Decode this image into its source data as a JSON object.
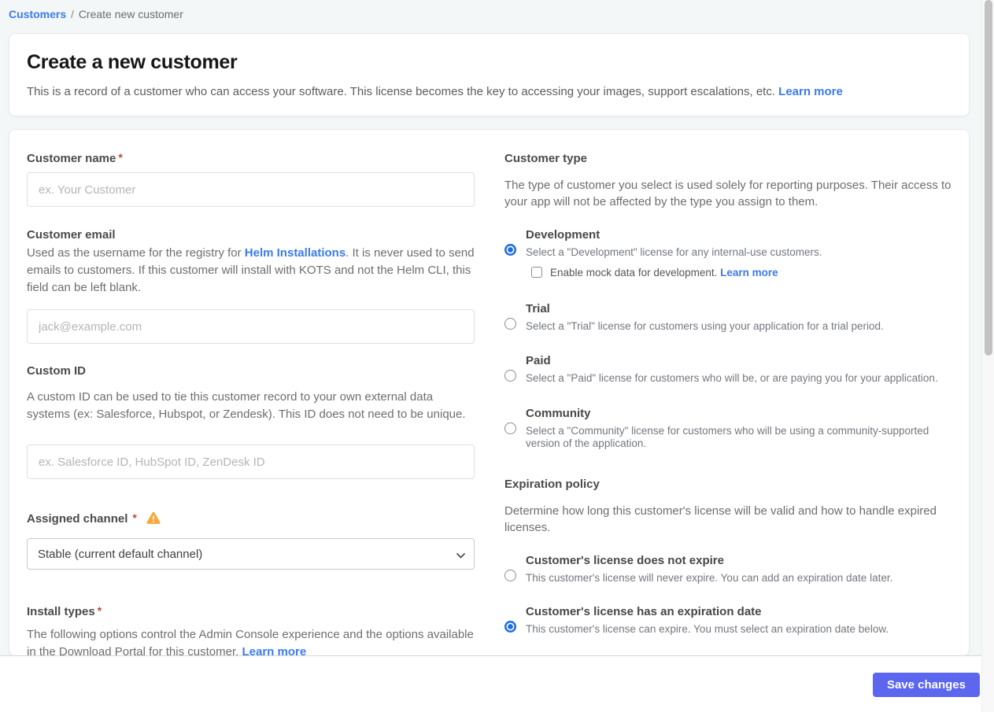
{
  "breadcrumb": {
    "link": "Customers",
    "separator": "/",
    "current": "Create new customer"
  },
  "header": {
    "title": "Create a new customer",
    "description": "This is a record of a customer who can access your software. This license becomes the key to accessing your images, support escalations, etc. ",
    "learn_more": "Learn more"
  },
  "ui": {
    "required_mark": "*"
  },
  "form": {
    "customer_name": {
      "label": "Customer name",
      "placeholder": "ex. Your Customer"
    },
    "customer_email": {
      "label": "Customer email",
      "description_before_link": "Used as the username for the registry for ",
      "link": "Helm Installations",
      "description_after_link": ". It is never used to send emails to customers. If this customer will install with KOTS and not the Helm CLI, this field can be left blank.",
      "placeholder": "jack@example.com"
    },
    "custom_id": {
      "label": "Custom ID",
      "description": "A custom ID can be used to tie this customer record to your own external data systems (ex: Salesforce, Hubspot, or Zendesk). This ID does not need to be unique.",
      "placeholder": "ex. Salesforce ID, HubSpot ID, ZenDesk ID"
    },
    "assigned_channel": {
      "label": "Assigned channel",
      "selected_option": "Stable (current default channel)"
    },
    "install_types": {
      "label": "Install types",
      "description": "The following options control the Admin Console experience and the options available in the Download Portal for this customer. ",
      "learn_more": "Learn more"
    }
  },
  "customer_type": {
    "heading": "Customer type",
    "description": "The type of customer you select is used solely for reporting purposes. Their access to your app will not be affected by the type you assign to them.",
    "options": [
      {
        "title": "Development",
        "description": "Select a \"Development\" license for any internal-use customers.",
        "selected": true,
        "checkbox_label": "Enable mock data for development. ",
        "checkbox_link": "Learn more",
        "checkbox_checked": false
      },
      {
        "title": "Trial",
        "description": "Select a \"Trial\" license for customers using your application for a trial period.",
        "selected": false
      },
      {
        "title": "Paid",
        "description": "Select a \"Paid\" license for customers who will be, or are paying you for your application.",
        "selected": false
      },
      {
        "title": "Community",
        "description": "Select a \"Community\" license for customers who will be using a community-supported version of the application.",
        "selected": false
      }
    ]
  },
  "expiration_policy": {
    "heading": "Expiration policy",
    "description": "Determine how long this customer's license will be valid and how to handle expired licenses.",
    "options": [
      {
        "title": "Customer's license does not expire",
        "description": "This customer's license will never expire. You can add an expiration date later.",
        "selected": false
      },
      {
        "title": "Customer's license has an expiration date",
        "description": "This customer's license can expire. You must select an expiration date below.",
        "selected": true
      }
    ]
  },
  "footer": {
    "save_button": "Save changes"
  },
  "colors": {
    "link": "#3b7cec",
    "accent_button": "#5c66ee",
    "radio_selected": "#1d6ce2",
    "required_mark": "#bf4342",
    "warning_icon": "#f7a83d",
    "page_background": "#f3f7f8"
  }
}
